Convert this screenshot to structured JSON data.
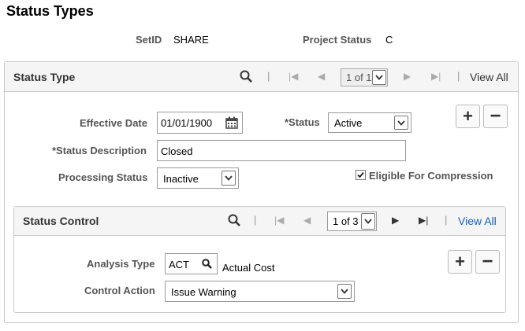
{
  "page": {
    "title": "Status Types"
  },
  "header": {
    "setid_label": "SetID",
    "setid_value": "SHARE",
    "project_status_label": "Project Status",
    "project_status_value": "C"
  },
  "status_type": {
    "title": "Status Type",
    "pager": "1 of 1",
    "view_all": "View All",
    "effective_date_label": "Effective Date",
    "effective_date_value": "01/01/1900",
    "status_label": "*Status",
    "status_value": "Active",
    "status_desc_label": "*Status Description",
    "status_desc_value": "Closed",
    "processing_status_label": "Processing Status",
    "processing_status_value": "Inactive",
    "eligible_label": "Eligible For Compression",
    "eligible_checked": true,
    "add_label": "+",
    "delete_label": "−"
  },
  "status_control": {
    "title": "Status Control",
    "pager": "1 of 3",
    "view_all": "View All",
    "analysis_type_label": "Analysis Type",
    "analysis_type_value": "ACT",
    "analysis_type_desc": "Actual Cost",
    "control_action_label": "Control Action",
    "control_action_value": "Issue Warning",
    "add_label": "+",
    "delete_label": "−"
  },
  "nav_glyphs": {
    "first": "|◀",
    "prev": "◀",
    "next": "▶",
    "last": "▶|",
    "sep": "|"
  },
  "colors": {
    "link": "#1a5fb4",
    "panel_header": "#f5f5f5",
    "border": "#c8c8c8"
  }
}
